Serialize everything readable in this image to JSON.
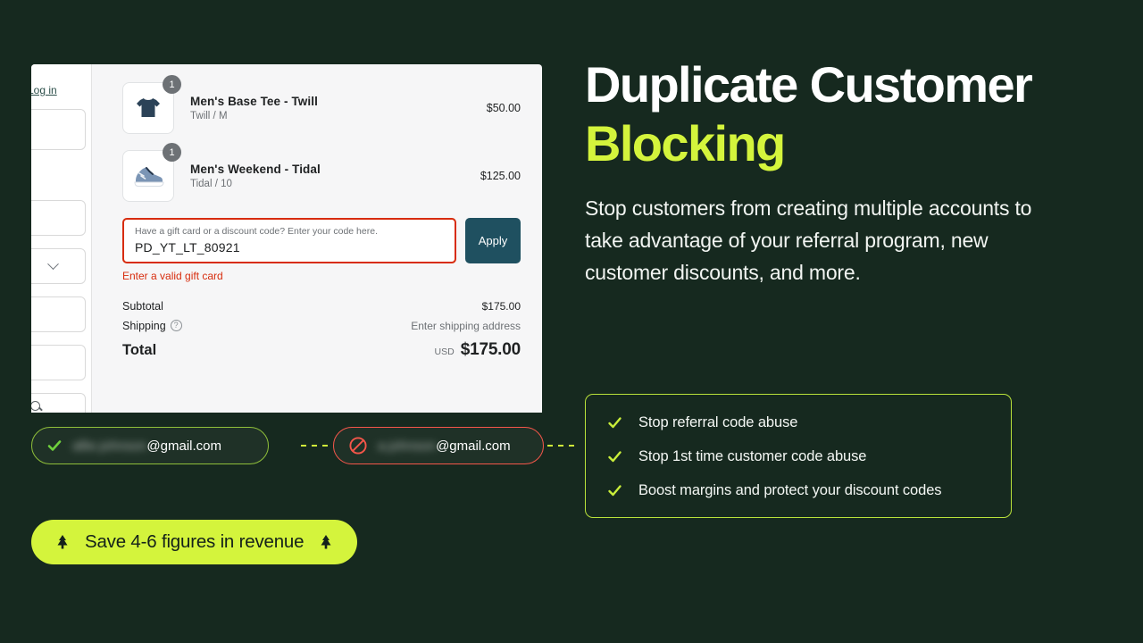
{
  "theme": {
    "background": "#16291f",
    "accent_lime": "#d4f43c",
    "feature_border": "#b9e23a",
    "error_red": "#d72c0d",
    "blocked_red": "#f4564a",
    "ok_green": "#8fbf3a",
    "apply_teal": "#1f5060"
  },
  "checkout": {
    "login_label": "Log in",
    "items": [
      {
        "title": "Men's Base Tee - Twill",
        "variant": "Twill / M",
        "price": "$50.00",
        "qty": "1",
        "thumb": "tshirt-icon"
      },
      {
        "title": "Men's Weekend - Tidal",
        "variant": "Tidal / 10",
        "price": "$125.00",
        "qty": "1",
        "thumb": "sneaker-icon"
      }
    ],
    "discount": {
      "placeholder": "Have a gift card or a discount code? Enter your code here.",
      "value": "PD_YT_LT_80921",
      "apply_label": "Apply",
      "error": "Enter a valid gift card"
    },
    "totals": {
      "subtotal_label": "Subtotal",
      "subtotal_value": "$175.00",
      "shipping_label": "Shipping",
      "shipping_value": "Enter shipping address",
      "help_glyph": "?",
      "total_label": "Total",
      "total_currency": "USD",
      "total_value": "$175.00"
    }
  },
  "pills": {
    "allowed": {
      "name": "allie.johnson",
      "domain": "@gmail.com",
      "icon": "check-icon"
    },
    "blocked": {
      "name": "a.johnson",
      "domain": "@gmail.com",
      "icon": "blocked-icon"
    }
  },
  "cta": {
    "label": "Save 4-6 figures in revenue",
    "left_icon": "tree-icon",
    "right_icon": "tree-icon"
  },
  "hero": {
    "title_line1": "Duplicate Customer",
    "title_line2": "Blocking",
    "body": "Stop customers from creating multiple accounts to take advantage of your referral program, new customer discounts, and more."
  },
  "features": [
    {
      "label": "Stop referral code abuse",
      "icon": "check-icon"
    },
    {
      "label": "Stop 1st time customer code abuse",
      "icon": "check-icon"
    },
    {
      "label": "Boost margins and protect your discount codes",
      "icon": "check-icon"
    }
  ]
}
